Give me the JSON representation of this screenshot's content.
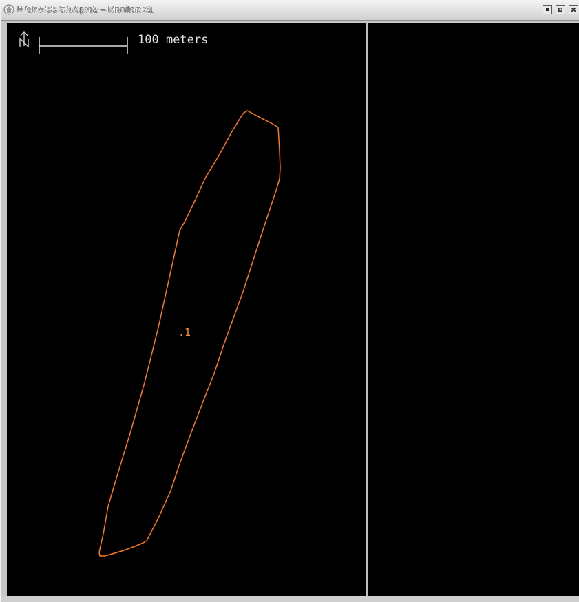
{
  "window": {
    "title": "GRASS 5.0.0pre2 – Monitor: x1"
  },
  "titlebar_buttons": {
    "minimize_icon": "minimize-icon",
    "maximize_icon": "maximize-icon",
    "close_icon": "close-icon"
  },
  "map": {
    "scale_label": "100 meters",
    "north_arrow_letter": "N",
    "area_label": ".1",
    "colors": {
      "background": "#000000",
      "boundary": "#ff7a1a",
      "label": "#ff8a3a",
      "scale": "#e0e0e0",
      "frame": "#bfbfbf"
    }
  }
}
